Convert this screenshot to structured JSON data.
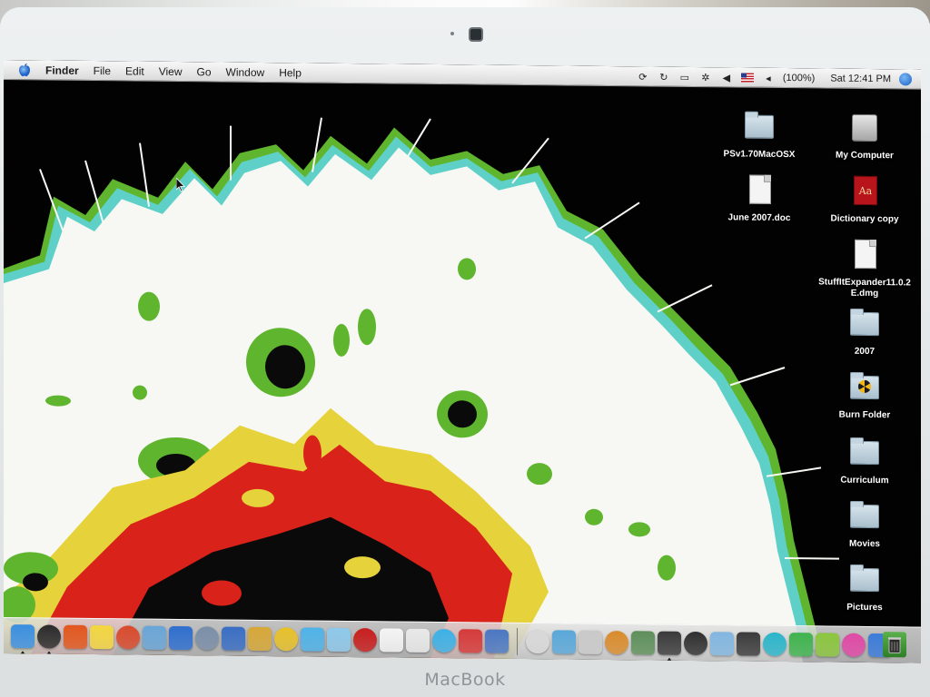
{
  "device": {
    "brand_label": "MacBook"
  },
  "menubar": {
    "app_name": "Finder",
    "menus": [
      "File",
      "Edit",
      "View",
      "Go",
      "Window",
      "Help"
    ],
    "battery_percent": "(100%)",
    "clock": "Sat 12:41 PM",
    "extras_icons": [
      "sync-icon",
      "time-machine-icon",
      "display-icon",
      "bluetooth-icon",
      "volume-icon",
      "us-flag-icon",
      "battery-icon",
      "spotlight-icon"
    ]
  },
  "desktop": {
    "icons": [
      {
        "label": "PSv1.70MacOSX",
        "kind": "folder"
      },
      {
        "label": "My Computer",
        "kind": "hard-drive"
      },
      {
        "label": "June 2007.doc",
        "kind": "document"
      },
      {
        "label": "Dictionary copy",
        "kind": "dictionary"
      },
      {
        "label": "StuffItExpander11.0.2\nE.dmg",
        "kind": "disk-image"
      },
      {
        "label": "2007",
        "kind": "folder"
      },
      {
        "label": "Burn Folder",
        "kind": "burn-folder"
      },
      {
        "label": "Curriculum",
        "kind": "folder"
      },
      {
        "label": "Movies",
        "kind": "folder"
      },
      {
        "label": "Pictures",
        "kind": "folder"
      }
    ]
  },
  "dock": {
    "items": [
      {
        "name": "finder-dock-icon",
        "color": "#3b8fe0",
        "running": true
      },
      {
        "name": "dvd-player-dock-icon",
        "color": "#2b2b2b",
        "running": true
      },
      {
        "name": "firefox-dock-icon",
        "color": "#e2571e",
        "running": false
      },
      {
        "name": "stickies-dock-icon",
        "color": "#f2d640",
        "running": false
      },
      {
        "name": "textedit-dock-icon",
        "color": "#d94a2c",
        "running": false
      },
      {
        "name": "preview-dock-icon",
        "color": "#6aa6d8",
        "running": false
      },
      {
        "name": "itunes-dock-icon",
        "color": "#2f6fcf",
        "running": false
      },
      {
        "name": "script-editor-dock-icon",
        "color": "#7b8fa8",
        "running": false
      },
      {
        "name": "keynote-dock-icon",
        "color": "#3a6ec4",
        "running": false
      },
      {
        "name": "folders-dock-icon",
        "color": "#d7a838",
        "running": false
      },
      {
        "name": "garageband-dock-icon",
        "color": "#e7c12a",
        "running": false
      },
      {
        "name": "safari-dock-icon",
        "color": "#4fb3e8",
        "running": false
      },
      {
        "name": "music-note-dock-icon",
        "color": "#8ec8ea",
        "running": false
      },
      {
        "name": "photo-booth-dock-icon",
        "color": "#c81e1e",
        "running": false
      },
      {
        "name": "ical-dock-icon",
        "color": "#f4f4f4",
        "running": false
      },
      {
        "name": "magnifier-dock-icon",
        "color": "#e9e9e9",
        "running": false
      },
      {
        "name": "ichat-dock-icon",
        "color": "#3db1e6",
        "running": false
      },
      {
        "name": "mail-dock-icon",
        "color": "#d63a3a",
        "running": false
      },
      {
        "name": "imovie-dock-icon",
        "color": "#4b78c2",
        "running": false
      },
      {
        "name": "blank-dock-icon",
        "color": "#d8d8d8",
        "running": false
      },
      {
        "name": "dashboard-dock-icon",
        "color": "#59a7d9",
        "running": false
      },
      {
        "name": "utility-dock-icon",
        "color": "#c9c9c9",
        "running": false
      },
      {
        "name": "presentation-dock-icon",
        "color": "#d98b2c",
        "running": false
      },
      {
        "name": "grapher-dock-icon",
        "color": "#5e8f5a",
        "running": false
      },
      {
        "name": "console-dock-icon",
        "color": "#3a3a3a",
        "running": true
      },
      {
        "name": "chart-dock-icon",
        "color": "#2f2f2f",
        "running": false
      },
      {
        "name": "tool-dock-icon",
        "color": "#82b6e0",
        "running": false
      },
      {
        "name": "car-dock-icon",
        "color": "#3b3b3b",
        "running": false
      },
      {
        "name": "letter-s-dock-icon",
        "color": "#2bb5c9",
        "running": false
      },
      {
        "name": "letter-w-dock-icon",
        "color": "#3fb34d",
        "running": false
      },
      {
        "name": "letter-x-dock-icon",
        "color": "#8cc63f",
        "running": false
      },
      {
        "name": "letter-p-dock-icon",
        "color": "#e04aa6",
        "running": false
      },
      {
        "name": "letter-q-dock-icon",
        "color": "#3c7cd9",
        "running": false
      }
    ],
    "trash_icon": "trash-icon"
  },
  "colors": {
    "menubar_bg": "#e8e8e8",
    "desktop_bg": "#020202",
    "wallpaper_white": "#f7f8f3",
    "wallpaper_red": "#d8221a",
    "wallpaper_yellow": "#e6d23a",
    "wallpaper_green": "#5fb52e",
    "wallpaper_cyan": "#5fd0c8"
  }
}
